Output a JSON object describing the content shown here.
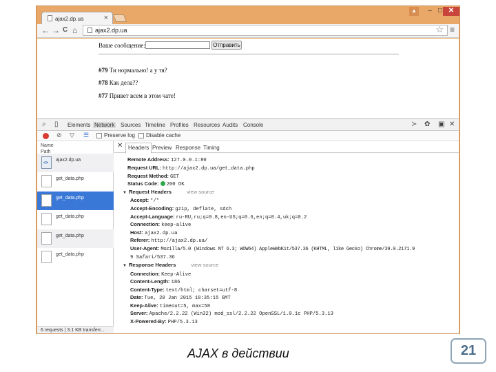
{
  "browser": {
    "tab_title": "ajax2.dp.ua",
    "tab_close": "×",
    "window_controls": {
      "user": "▲",
      "minimize": "–",
      "maximize": "□",
      "close": "✕"
    },
    "nav": {
      "back": "←",
      "forward": "→",
      "reload": "C",
      "home": "⌂"
    },
    "url": "ajax2.dp.ua",
    "star": "☆",
    "menu": "≡"
  },
  "page": {
    "message_label": "Ваше сообщение:",
    "message_value": "",
    "send_button": "Отправить",
    "messages": [
      {
        "id": "#79",
        "text": " Ти нормально! а у тя?"
      },
      {
        "id": "#78",
        "text": " Как дела??"
      },
      {
        "id": "#77",
        "text": " Привет всем в этом чате!"
      }
    ]
  },
  "devtools": {
    "panels": [
      "Elements",
      "Network",
      "Sources",
      "Timeline",
      "Profiles",
      "Resources",
      "Audits",
      "Console"
    ],
    "active_panel": "Network",
    "toolbar": {
      "preserve_log": "Preserve log",
      "disable_cache": "Disable cache"
    },
    "list_header": {
      "name": "Name",
      "path": "Path"
    },
    "requests": [
      "ajax2.dp.ua",
      "get_data.php",
      "get_data.php",
      "get_data.php",
      "get_data.php",
      "get_data.php"
    ],
    "selected_index": 2,
    "footer": "6 requests | 3.1 KB transferr...",
    "detail_tabs": [
      "Headers",
      "Preview",
      "Response",
      "Timing"
    ],
    "general": [
      {
        "k": "Remote Address:",
        "v": "127.0.0.1:80"
      },
      {
        "k": "Request URL:",
        "v": "http://ajax2.dp.ua/get_data.php"
      },
      {
        "k": "Request Method:",
        "v": "GET"
      },
      {
        "k": "Status Code:",
        "v": "200 OK"
      }
    ],
    "request_headers_title": "Request Headers",
    "response_headers_title": "Response Headers",
    "view_source": "view source",
    "request_headers": [
      {
        "k": "Accept:",
        "v": "*/*"
      },
      {
        "k": "Accept-Encoding:",
        "v": "gzip, deflate, sdch"
      },
      {
        "k": "Accept-Language:",
        "v": "ru-RU,ru;q=0.8,en-US;q=0.6,en;q=0.4,uk;q=0.2"
      },
      {
        "k": "Connection:",
        "v": "keep-alive"
      },
      {
        "k": "Host:",
        "v": "ajax2.dp.ua"
      },
      {
        "k": "Referer:",
        "v": "http://ajax2.dp.ua/"
      },
      {
        "k": "User-Agent:",
        "v": "Mozilla/5.0 (Windows NT 6.3; WOW64) AppleWebKit/537.36 (KHTML, like Gecko) Chrome/39.0.2171.9"
      },
      {
        "k": "",
        "v": "9 Safari/537.36"
      }
    ],
    "response_headers": [
      {
        "k": "Connection:",
        "v": "Keep-Alive"
      },
      {
        "k": "Content-Length:",
        "v": "186"
      },
      {
        "k": "Content-Type:",
        "v": "text/html; charset=utf-8"
      },
      {
        "k": "Date:",
        "v": "Tue, 20 Jan 2015 18:35:15 GMT"
      },
      {
        "k": "Keep-Alive:",
        "v": "timeout=5, max=58"
      },
      {
        "k": "Server:",
        "v": "Apache/2.2.22 (Win32) mod_ssl/2.2.22 OpenSSL/1.0.1c PHP/5.3.13"
      },
      {
        "k": "X-Powered-By:",
        "v": "PHP/5.3.13"
      }
    ]
  },
  "slide": {
    "caption": "AJAX в действии",
    "page_number": "21"
  },
  "colors": {
    "window_frame": "#e9a867",
    "selected_row": "#3a78d8",
    "record": "#d93a30",
    "status_ok": "#2fa84a",
    "badge_border": "#8da4b6"
  }
}
